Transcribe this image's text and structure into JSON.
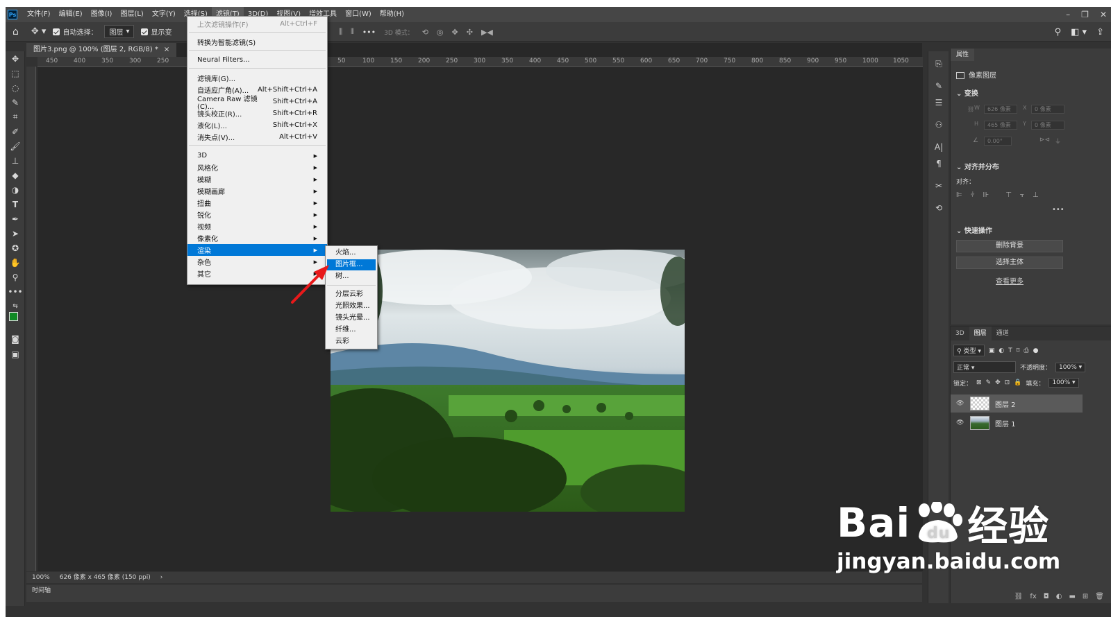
{
  "menubar": {
    "logo": "Ps",
    "items": [
      "文件(F)",
      "编辑(E)",
      "图像(I)",
      "图层(L)",
      "文字(Y)",
      "选择(S)",
      "滤镜(T)",
      "3D(D)",
      "视图(V)",
      "增效工具",
      "窗口(W)",
      "帮助(H)"
    ],
    "active_index": 6
  },
  "options": {
    "auto_select_label": "自动选择：",
    "auto_select_target": "图层",
    "show_transform_label": "显示变",
    "mode_3d_label": "3D 模式："
  },
  "document": {
    "tab_title": "图片3.png @ 100% (图层 2, RGB/8) *",
    "zoom": "100%",
    "doc_size": "626 像素 x 465 像素 (150 ppi)",
    "timeline_label": "时间轴"
  },
  "ruler_top": [
    "450",
    "400",
    "350",
    "300",
    "250",
    "50",
    "100",
    "150",
    "200",
    "250",
    "300",
    "350",
    "400",
    "450",
    "500",
    "550",
    "600",
    "650",
    "700",
    "750",
    "800",
    "850",
    "900",
    "950",
    "1000",
    "1050"
  ],
  "filter_menu": {
    "items": [
      {
        "label": "上次滤镜操作(F)",
        "shortcut": "Alt+Ctrl+F",
        "disabled": true
      },
      {
        "label": "转换为智能滤镜(S)",
        "shortcut": ""
      },
      {
        "label": "Neural Filters...",
        "shortcut": ""
      },
      {
        "label": "滤镜库(G)...",
        "shortcut": ""
      },
      {
        "label": "自适应广角(A)...",
        "shortcut": "Alt+Shift+Ctrl+A"
      },
      {
        "label": "Camera Raw 滤镜(C)...",
        "shortcut": "Shift+Ctrl+A"
      },
      {
        "label": "镜头校正(R)...",
        "shortcut": "Shift+Ctrl+R"
      },
      {
        "label": "液化(L)...",
        "shortcut": "Shift+Ctrl+X"
      },
      {
        "label": "消失点(V)...",
        "shortcut": "Alt+Ctrl+V"
      },
      {
        "label": "3D",
        "submenu": true
      },
      {
        "label": "风格化",
        "submenu": true
      },
      {
        "label": "模糊",
        "submenu": true
      },
      {
        "label": "模糊画廊",
        "submenu": true
      },
      {
        "label": "扭曲",
        "submenu": true
      },
      {
        "label": "锐化",
        "submenu": true
      },
      {
        "label": "视频",
        "submenu": true
      },
      {
        "label": "像素化",
        "submenu": true
      },
      {
        "label": "渲染",
        "submenu": true,
        "highlight": true
      },
      {
        "label": "杂色",
        "submenu": true
      },
      {
        "label": "其它",
        "submenu": true
      }
    ]
  },
  "render_submenu": {
    "items": [
      "火焰...",
      "图片框...",
      "树...",
      "分层云彩",
      "光照效果...",
      "镜头光晕...",
      "纤维...",
      "云彩"
    ],
    "highlight_index": 1
  },
  "properties": {
    "tab": "属性",
    "layer_type": "像素图层",
    "transform_label": "变换",
    "w": "626 像素",
    "h": "465 像素",
    "x": "0 像素",
    "y": "0 像素",
    "angle": "0.00°",
    "align_label": "对齐并分布",
    "align_sub": "对齐：",
    "quick_actions_label": "快速操作",
    "remove_bg": "删除背景",
    "select_subject": "选择主体",
    "see_more": "查看更多"
  },
  "layers_panel": {
    "tabs": [
      "3D",
      "图层",
      "通道"
    ],
    "active_tab": 1,
    "kind_label": "类型",
    "blend_mode": "正常",
    "opacity_label": "不透明度：",
    "opacity": "100%",
    "lock_label": "锁定：",
    "fill_label": "填充：",
    "fill": "100%",
    "layers": [
      {
        "name": "图层 2",
        "selected": true
      },
      {
        "name": "图层 1",
        "selected": false
      }
    ]
  },
  "watermark": {
    "brand_left": "Bai",
    "brand_right": "经验",
    "url": "jingyan.baidu.com"
  },
  "colors": {
    "highlight": "#0078d7",
    "foreground_swatch": "#0f8a24",
    "arrow": "#e8191a"
  }
}
